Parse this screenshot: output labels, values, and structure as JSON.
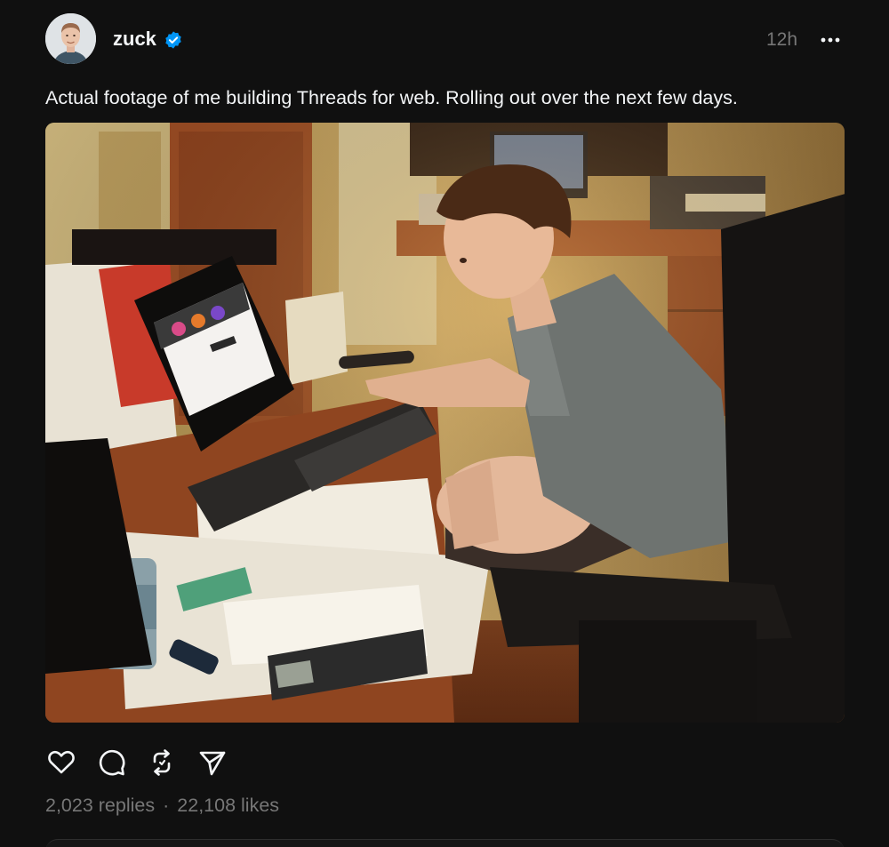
{
  "post": {
    "author": {
      "username": "zuck",
      "verified": true
    },
    "timestamp": "12h",
    "caption": "Actual footage of me building Threads for web. Rolling out over the next few days.",
    "stats": {
      "replies": "2,023 replies",
      "separator": "·",
      "likes": "22,108 likes"
    }
  },
  "icons": {
    "more": "more-horizontal-icon",
    "like": "heart-icon",
    "reply": "comment-bubble-icon",
    "repost": "repost-icon",
    "share": "send-icon",
    "verified": "verified-badge-icon"
  },
  "colors": {
    "background": "#101010",
    "text_primary": "#f3f5f7",
    "text_secondary": "#777777",
    "verified": "#0095f6"
  }
}
